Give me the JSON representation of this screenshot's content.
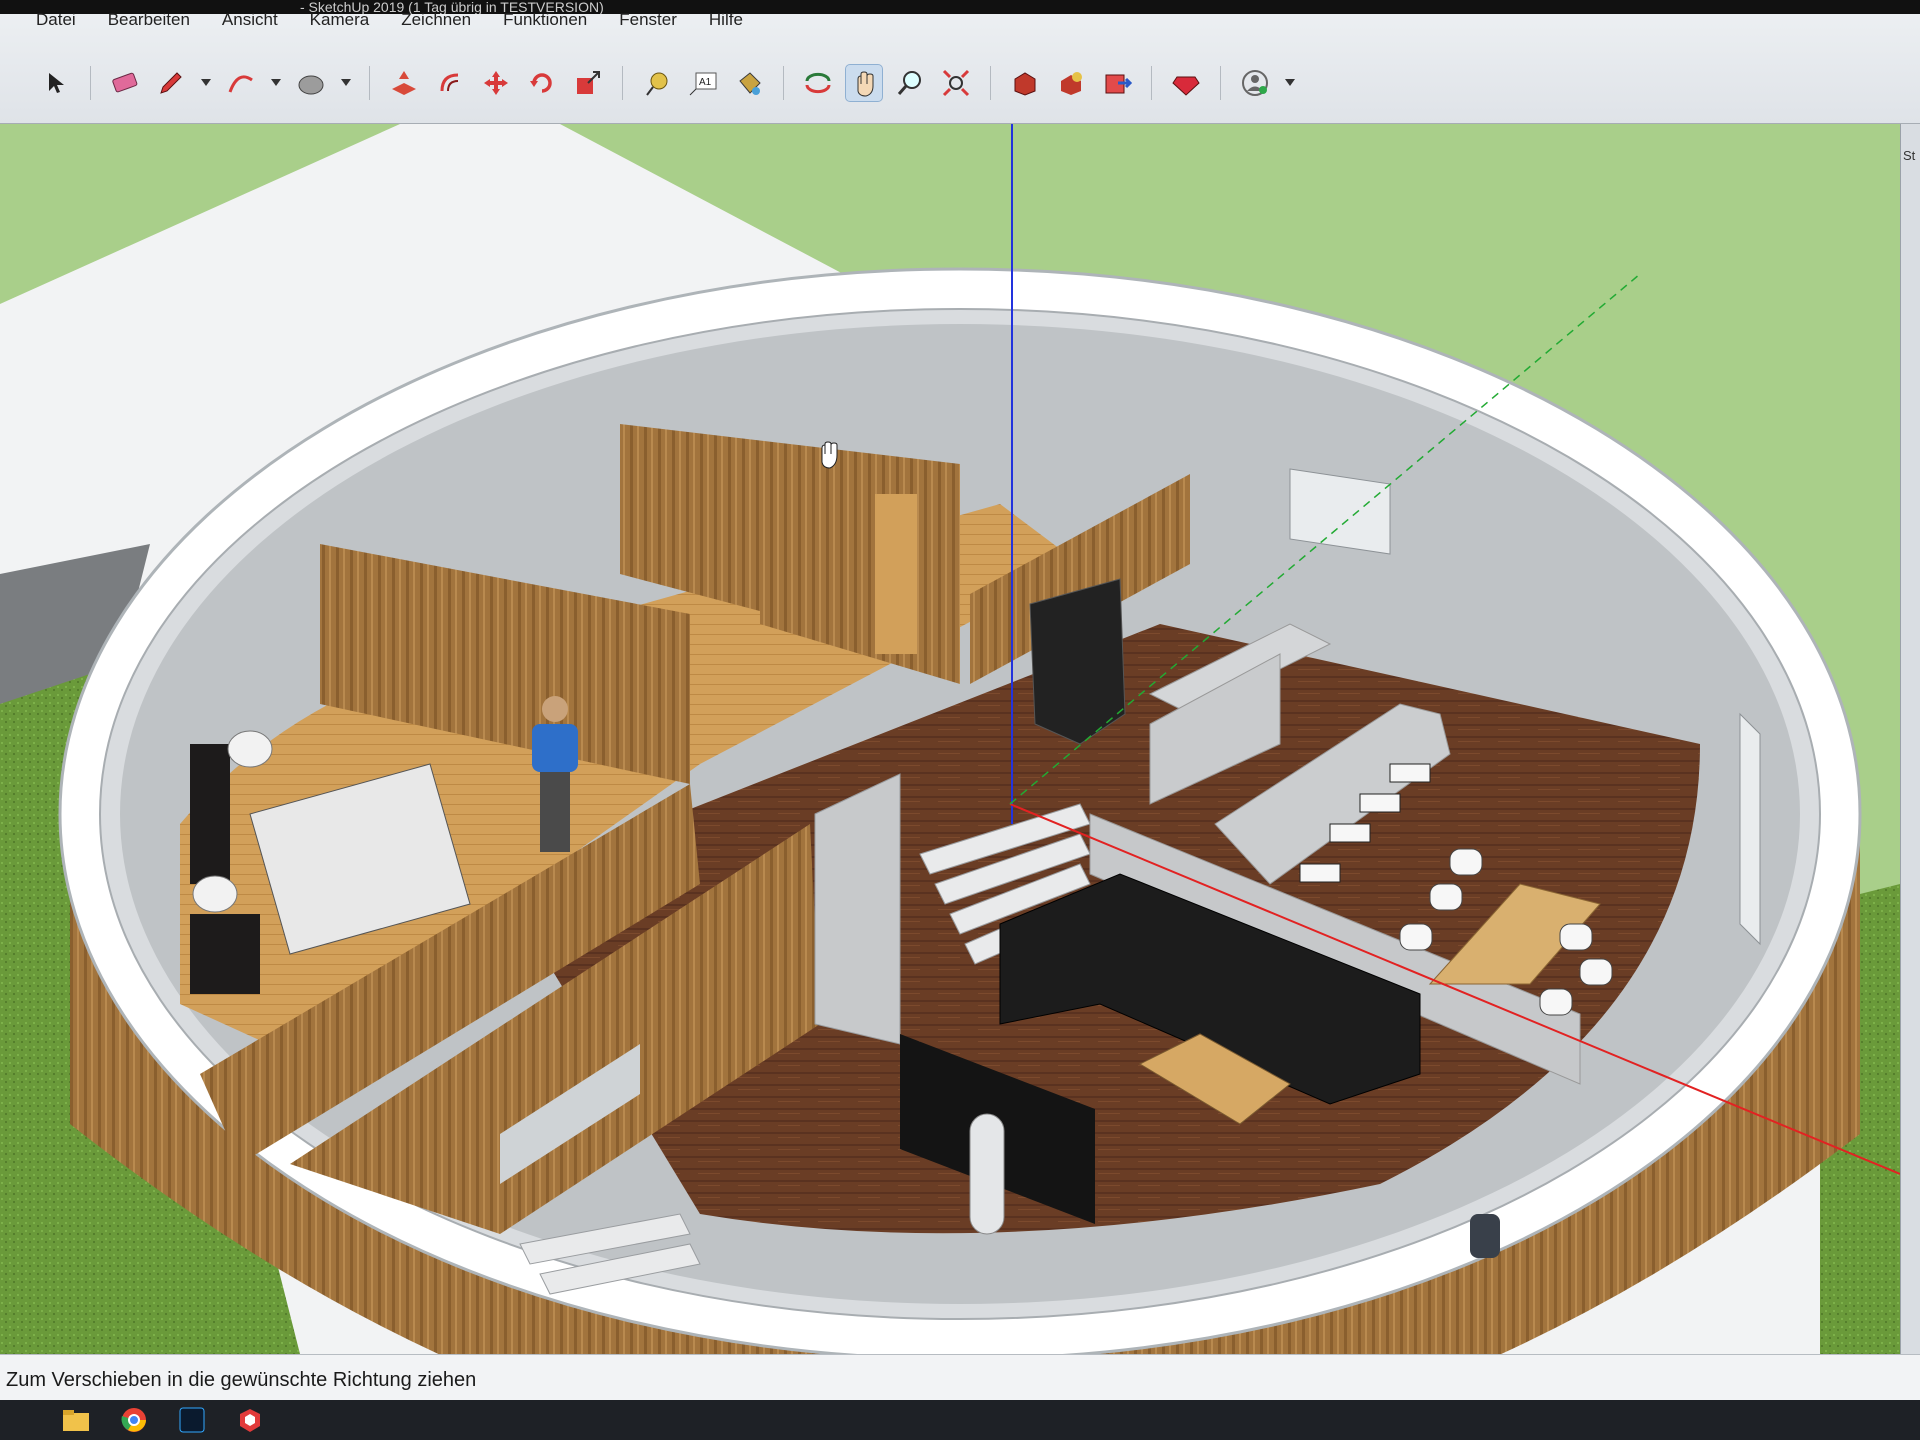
{
  "window": {
    "title": "- SketchUp 2019 (1 Tag übrig in TESTVERSION)"
  },
  "menubar": {
    "items": [
      "Datei",
      "Bearbeiten",
      "Ansicht",
      "Kamera",
      "Zeichnen",
      "Funktionen",
      "Fenster",
      "Hilfe"
    ]
  },
  "toolbar": {
    "text_tool_label": "A1",
    "tools": [
      {
        "name": "select",
        "icon": "arrow-icon"
      },
      {
        "name": "eraser",
        "icon": "eraser-icon"
      },
      {
        "name": "pencil",
        "icon": "pencil-icon"
      },
      {
        "name": "arc",
        "icon": "arc-icon"
      },
      {
        "name": "shapes",
        "icon": "circle-icon"
      },
      {
        "name": "push-pull",
        "icon": "push-pull-icon"
      },
      {
        "name": "offset",
        "icon": "offset-icon"
      },
      {
        "name": "move",
        "icon": "move-icon"
      },
      {
        "name": "rotate",
        "icon": "rotate-icon"
      },
      {
        "name": "scale",
        "icon": "scale-icon"
      },
      {
        "name": "tape-measure",
        "icon": "tape-measure-icon"
      },
      {
        "name": "text",
        "icon": "text-icon"
      },
      {
        "name": "paint-bucket",
        "icon": "paint-bucket-icon"
      },
      {
        "name": "orbit",
        "icon": "orbit-icon"
      },
      {
        "name": "pan",
        "icon": "hand-icon"
      },
      {
        "name": "zoom",
        "icon": "zoom-icon"
      },
      {
        "name": "zoom-extents",
        "icon": "zoom-extents-icon"
      },
      {
        "name": "warehouse",
        "icon": "warehouse-icon"
      },
      {
        "name": "extension-warehouse",
        "icon": "extension-icon"
      },
      {
        "name": "send-to-layout",
        "icon": "layout-icon"
      },
      {
        "name": "extension-manager",
        "icon": "gem-icon"
      },
      {
        "name": "account",
        "icon": "user-icon"
      }
    ],
    "active_tool": "pan"
  },
  "colors": {
    "toolbar_bg": "#e4e8ec",
    "grass": "#a9cf8a",
    "wood_wall": "#a2743d",
    "wood_floor_dark": "#6a3d25",
    "wood_floor_light": "#d2a05a",
    "concrete": "#c4c6c8",
    "axis_red": "#e22222",
    "axis_blue": "#2233dd",
    "axis_green": "#22aa33"
  },
  "side_tray": {
    "label": "St"
  },
  "status": {
    "text": "Zum Verschieben in die gewünschte Richtung ziehen"
  },
  "taskbar": {
    "apps": [
      "file-explorer-icon",
      "chrome-icon",
      "photoshop-icon",
      "sketchup-icon"
    ]
  }
}
